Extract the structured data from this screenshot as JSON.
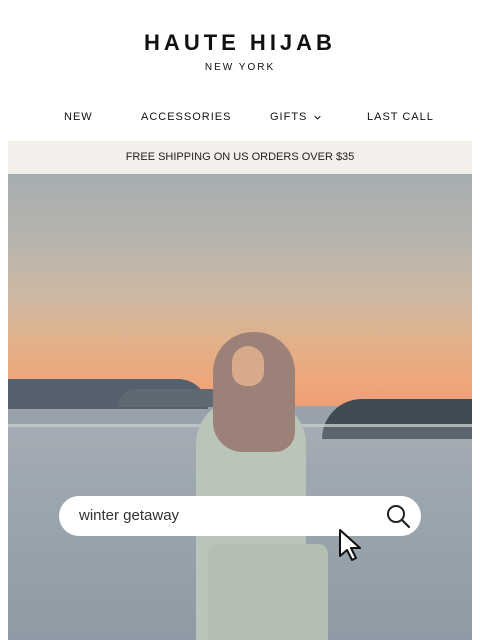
{
  "brand": {
    "name": "HAUTE HIJAB",
    "tagline": "NEW YORK"
  },
  "nav": {
    "items": [
      {
        "label": "NEW"
      },
      {
        "label": "ACCESSORIES"
      },
      {
        "label": "GIFTS"
      },
      {
        "label": "LAST CALL"
      }
    ],
    "gifts_dropdown_icon": "chevron-down-icon"
  },
  "banner": {
    "text": "FREE SHIPPING ON US ORDERS OVER $35"
  },
  "hero": {
    "search": {
      "value": "winter getaway",
      "icon": "search-icon"
    },
    "cursor_icon": "pointer-cursor-icon"
  }
}
